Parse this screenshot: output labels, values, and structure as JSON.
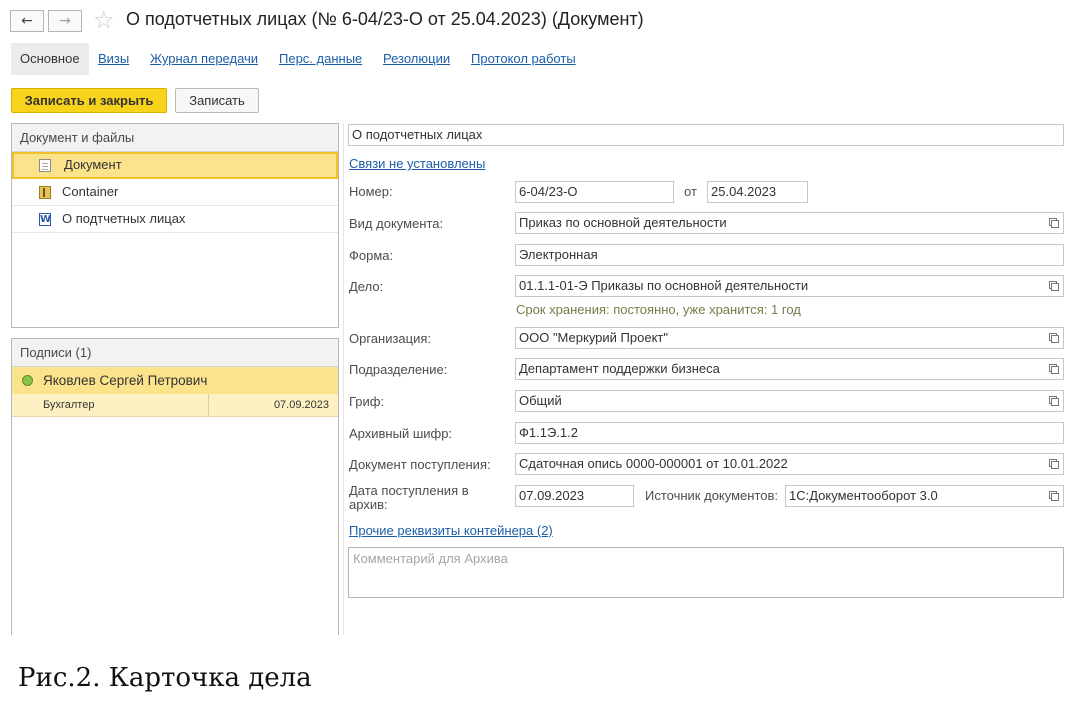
{
  "window": {
    "title": "О подотчетных лицах (№ 6-04/23-О от 25.04.2023) (Документ)",
    "back_glyph": "←",
    "forward_glyph": "→",
    "star_glyph": "☆"
  },
  "tabs": [
    {
      "label": "Основное",
      "active": true
    },
    {
      "label": "Визы"
    },
    {
      "label": "Журнал передачи"
    },
    {
      "label": "Перс. данные"
    },
    {
      "label": "Резолюции"
    },
    {
      "label": "Протокол работы"
    }
  ],
  "toolbar": {
    "save_close_label": "Записать и закрыть",
    "save_label": "Записать"
  },
  "files_panel": {
    "title": "Документ и файлы",
    "items": [
      {
        "label": "Документ",
        "icon": "document-icon",
        "selected": true
      },
      {
        "label": "Container",
        "icon": "container-icon"
      },
      {
        "label": "О подтчетных лицах",
        "icon": "word-icon",
        "icon_glyph": "W"
      }
    ]
  },
  "signatures_panel": {
    "title": "Подписи (1)",
    "signer": "Яковлев Сергей Петрович",
    "role": "Бухгалтер",
    "date": "07.09.2023",
    "status_color": "#8cc34a"
  },
  "form": {
    "name_value": "О подотчетных лицах",
    "links_text": "Связи не установлены",
    "number_label": "Номер:",
    "number_value": "6-04/23-О",
    "from_label": "от",
    "date_value": "25.04.2023",
    "doc_type_label": "Вид документа:",
    "doc_type_value": "Приказ по основной деятельности",
    "form_label": "Форма:",
    "form_value": "Электронная",
    "case_label": "Дело:",
    "case_value": "01.1.1-01-Э Приказы по основной деятельности",
    "storage_note": "Срок хранения: постоянно, уже хранится: 1 год",
    "org_label": "Организация:",
    "org_value": "ООО \"Меркурий Проект\"",
    "dept_label": "Подразделение:",
    "dept_value": "Департамент поддержки бизнеса",
    "grif_label": "Гриф:",
    "grif_value": "Общий",
    "archive_code_label": "Архивный шифр:",
    "archive_code_value": "Ф1.1Э.1.2",
    "receipt_doc_label": "Документ поступления:",
    "receipt_doc_value": "Сдаточная опись 0000-000001 от 10.01.2022",
    "receipt_date_label": "Дата поступления в архив:",
    "receipt_date_value": "07.09.2023",
    "source_label": "Источник документов:",
    "source_value": "1С:Документооборот 3.0",
    "other_props_link": "Прочие реквизиты контейнера (2)",
    "comment_placeholder": "Комментарий для Архива"
  },
  "caption": "Рис.2. Карточка дела",
  "colors": {
    "accent_yellow": "#f7d41b",
    "selection": "#fbe38c",
    "link": "#1d5ea8"
  }
}
